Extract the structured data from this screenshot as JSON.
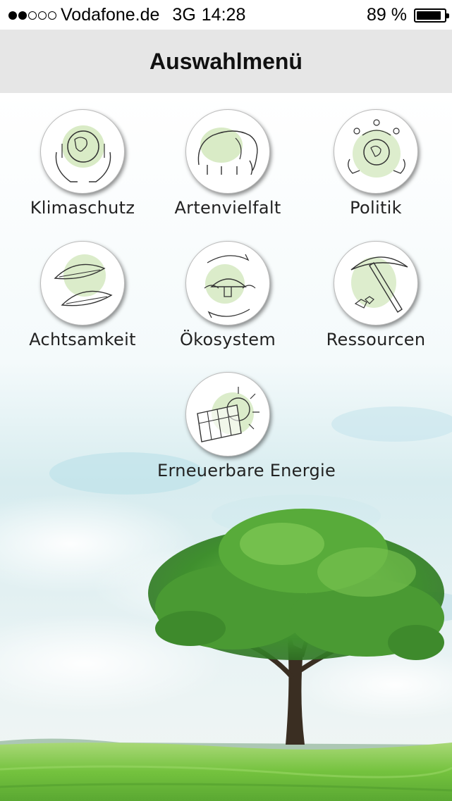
{
  "status_bar": {
    "signal_filled": 2,
    "signal_total": 5,
    "carrier": "Vodafone.de",
    "network": "3G",
    "time": "14:28",
    "battery_percent_text": "89 %",
    "battery_level": 0.89
  },
  "header": {
    "title": "Auswahlmenü"
  },
  "menu": {
    "items": [
      {
        "label": "Klimaschutz",
        "icon": "hands-globe-icon"
      },
      {
        "label": "Artenvielfalt",
        "icon": "elephant-icon"
      },
      {
        "label": "Politik",
        "icon": "people-around-globe-icon"
      },
      {
        "label": "Achtsamkeit",
        "icon": "leaves-icon"
      },
      {
        "label": "Ökosystem",
        "icon": "mushroom-cycle-icon"
      },
      {
        "label": "Ressourcen",
        "icon": "pickaxe-icon"
      },
      {
        "label": "Erneuerbare Energie",
        "icon": "solar-panel-icon"
      }
    ]
  },
  "colors": {
    "header_bg": "#e6e6e6",
    "icon_accent": "#cfe6b8",
    "grass": "#6fbf3c",
    "tree": "#3f8f2e"
  }
}
